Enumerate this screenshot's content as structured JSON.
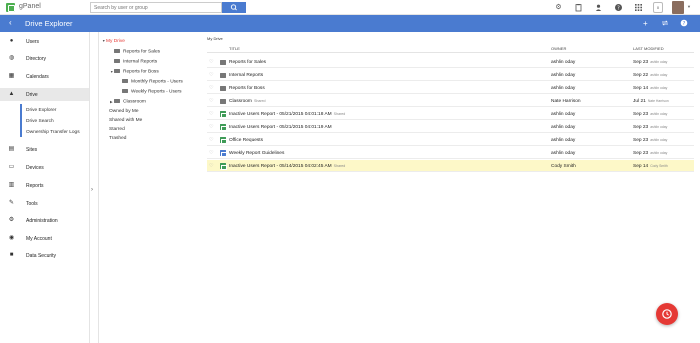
{
  "app": {
    "name": "gPanel"
  },
  "search": {
    "placeholder": "Search by user or group"
  },
  "notifications": {
    "count": "0"
  },
  "header": {
    "title": "Drive Explorer"
  },
  "sidebar": {
    "items": [
      {
        "label": "Users",
        "icon": "user-icon"
      },
      {
        "label": "Directory",
        "icon": "globe-icon"
      },
      {
        "label": "Calendars",
        "icon": "calendar-icon"
      },
      {
        "label": "Drive",
        "icon": "drive-icon",
        "active": true
      },
      {
        "label": "Sites",
        "icon": "sites-icon"
      },
      {
        "label": "Devices",
        "icon": "devices-icon"
      },
      {
        "label": "Reports",
        "icon": "reports-icon"
      },
      {
        "label": "Tools",
        "icon": "wrench-icon"
      },
      {
        "label": "Administration",
        "icon": "gear-icon"
      },
      {
        "label": "My Account",
        "icon": "account-icon"
      },
      {
        "label": "Data Security",
        "icon": "security-icon"
      }
    ],
    "drive_sub": [
      "Drive Explorer",
      "Drive Search",
      "Ownership Transfer Logs"
    ]
  },
  "tree": {
    "my_drive": "My Drive",
    "folders": [
      "Reports for Sales",
      "Internal Reports",
      "Reports for Boss",
      "Monthly Reports - Users",
      "Weekly Reports - Users",
      "Classroom"
    ],
    "filters": [
      "Owned by Me",
      "Shared with Me",
      "Starred",
      "Trashed"
    ]
  },
  "list": {
    "breadcrumb": "My Drive",
    "headers": {
      "title": "TITLE",
      "owner": "OWNER",
      "modified": "LAST MODIFIED"
    },
    "rows": [
      {
        "title": "Reports for Sales",
        "note": "",
        "owner": "ashlin oday",
        "date": "Sep 23",
        "by": "ashlin oday",
        "type": "folder"
      },
      {
        "title": "Internal Reports",
        "note": "",
        "owner": "ashlin oday",
        "date": "Sep 22",
        "by": "ashlin oday",
        "type": "folder"
      },
      {
        "title": "Reports for Boss",
        "note": "",
        "owner": "ashlin oday",
        "date": "Sep 14",
        "by": "ashlin oday",
        "type": "folder"
      },
      {
        "title": "Classroom",
        "note": "Shared",
        "owner": "Nate Harrison",
        "date": "Jul 21",
        "by": "Nate Harrison",
        "type": "shared"
      },
      {
        "title": "Inactive Users Report - 05/21/2015 04:01:18 AM",
        "note": "Shared",
        "owner": "ashlin oday",
        "date": "Sep 23",
        "by": "ashlin oday",
        "type": "sheet"
      },
      {
        "title": "Inactive Users Report - 05/21/2015 04:01:19 AM",
        "note": "",
        "owner": "ashlin oday",
        "date": "Sep 23",
        "by": "ashlin oday",
        "type": "sheet"
      },
      {
        "title": "Office Requests",
        "note": "",
        "owner": "ashlin oday",
        "date": "Sep 23",
        "by": "ashlin oday",
        "type": "sheet"
      },
      {
        "title": "Weekly Report Guidelines",
        "note": "",
        "owner": "ashlin oday",
        "date": "Sep 23",
        "by": "ashlin oday",
        "type": "doc"
      },
      {
        "title": "Inactive Users Report - 05/14/2015 04:02:45 AM",
        "note": "Shared",
        "owner": "Cody Smith",
        "date": "Sep 14",
        "by": "Cody Smith",
        "type": "sheet",
        "selected": true
      }
    ]
  },
  "colors": {
    "accent": "#4a7bd0",
    "fab": "#e53935",
    "selected_row": "#fdf8c8",
    "sheet": "#3e9b57"
  }
}
